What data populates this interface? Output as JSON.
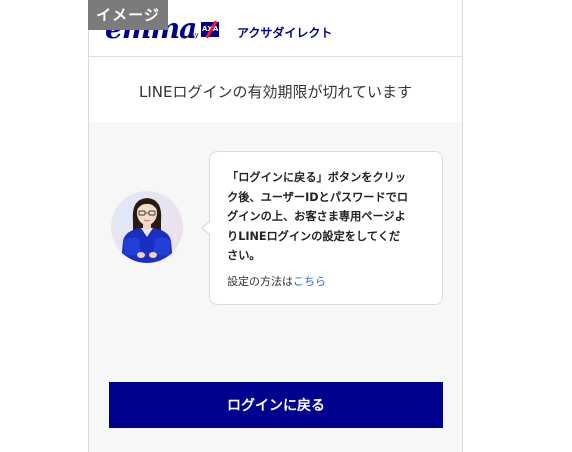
{
  "image_tag": "イメージ",
  "header": {
    "logo_emma": "emma",
    "logo_by": "by",
    "logo_axa": "AXA",
    "logo_brand": "アクサダイレクト"
  },
  "title": "LINEログインの有効期限が切れています",
  "avatar": {
    "icon": "assistant-avatar-icon"
  },
  "bubble": {
    "message_lines": [
      "「ログインに戻る」ボタンをクリッ",
      "ク後、ユーザーIDとパスワードでロ",
      "グインの上、お客さま専用ページよ",
      "りLINEログインの設定をしてくだ",
      "さい。"
    ],
    "settings_prefix": "設定の方法は",
    "settings_link": "こちら"
  },
  "button": {
    "label": "ログインに戻る"
  },
  "colors": {
    "brand": "#00008f",
    "axa_red": "#ff1721",
    "link": "#2b6cc4",
    "background": "#f7f7f7"
  }
}
